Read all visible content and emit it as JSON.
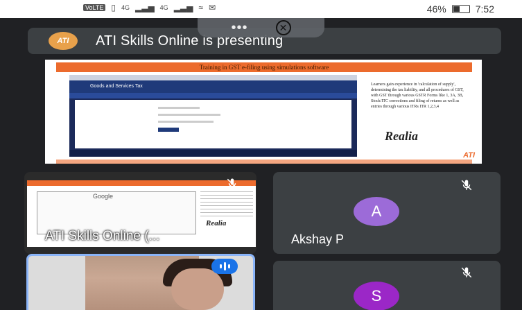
{
  "status_bar": {
    "carrier_badge": "VoLTE",
    "signal_1": "4G",
    "signal_2": "4G",
    "battery_percent": "46%",
    "battery_level": 0.46,
    "time": "7:52"
  },
  "banner": {
    "logo_text": "ATI",
    "presenting_text": "ATI Skills Online is presenting"
  },
  "overlay": {
    "more_icon": "more-horiz-icon",
    "close_icon": "close-icon"
  },
  "presentation": {
    "slide_title": "Training in GST e-filing using simulations software",
    "browser_nav": "Goods and Services Tax",
    "notes": "Learners gain experience in 'calculation of supply', determining the tax liability, and all procedures of GST, with GST through various GSTR Forms like 1, 3A, 3B, Stock/ITC corrections and filing of returns as well as entries through various ITRs ITR 1,2,3,4",
    "brand": "Realia",
    "corner_mark": "ATI"
  },
  "tiles": {
    "screen_share": {
      "label": "ATI Skills Online (...",
      "thumb_text": "Google",
      "thumb_brand": "Realia",
      "muted": true
    },
    "akshay": {
      "initial": "A",
      "name": "Akshay P",
      "muted": true,
      "avatar_color": "#9c6bd8"
    },
    "self_video": {
      "speaking": true,
      "border_color": "#8ab4f8"
    },
    "s_participant": {
      "initial": "S",
      "muted": true,
      "avatar_color": "#9b27c7"
    }
  }
}
